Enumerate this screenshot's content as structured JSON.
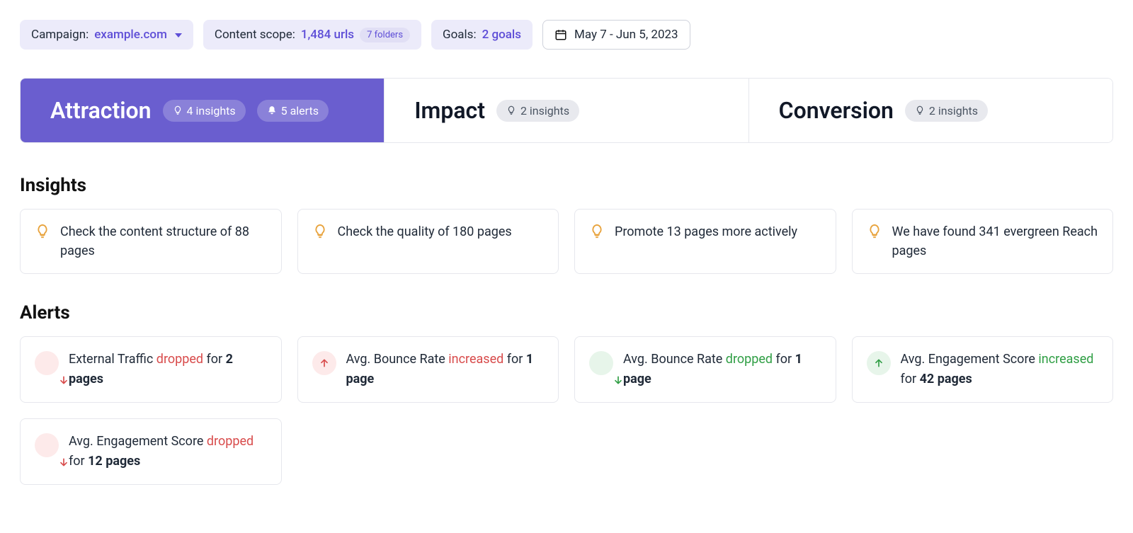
{
  "filters": {
    "campaign": {
      "label": "Campaign:",
      "value": "example.com"
    },
    "scope": {
      "label": "Content scope:",
      "value": "1,484 urls",
      "folders_badge": "7 folders"
    },
    "goals": {
      "label": "Goals:",
      "value": "2 goals"
    },
    "date": {
      "value": "May 7 - Jun 5, 2023"
    }
  },
  "tabs": {
    "attraction": {
      "title": "Attraction",
      "insights_badge": "4 insights",
      "alerts_badge": "5 alerts"
    },
    "impact": {
      "title": "Impact",
      "insights_badge": "2 insights"
    },
    "conversion": {
      "title": "Conversion",
      "insights_badge": "2 insights"
    }
  },
  "sections": {
    "insights_heading": "Insights",
    "alerts_heading": "Alerts"
  },
  "insights": [
    {
      "text": "Check the content structure of 88 pages"
    },
    {
      "text": "Check the quality of 180 pages"
    },
    {
      "text": "Promote 13 pages more actively"
    },
    {
      "text": "We have found 341 evergreen Reach pages"
    }
  ],
  "alerts": [
    {
      "icon": "down-red",
      "metric": "External Traffic",
      "verb": "dropped",
      "verb_class": "dropped",
      "for_text": "for",
      "pages": "2 pages"
    },
    {
      "icon": "up-red",
      "metric": "Avg. Bounce Rate",
      "verb": "increased",
      "verb_class": "increased-bad",
      "for_text": "for",
      "pages": "1 page"
    },
    {
      "icon": "down-green",
      "metric": "Avg. Bounce Rate",
      "verb": "dropped",
      "verb_class": "dropped-good",
      "for_text": "for",
      "pages": "1 page"
    },
    {
      "icon": "up-green",
      "metric": "Avg. Engagement Score",
      "verb": "increased",
      "verb_class": "increased-good",
      "for_text": "for",
      "pages": "42 pages"
    },
    {
      "icon": "down-red",
      "metric": "Avg. Engagement Score",
      "verb": "dropped",
      "verb_class": "dropped",
      "for_text": "for",
      "pages": "12 pages"
    }
  ]
}
